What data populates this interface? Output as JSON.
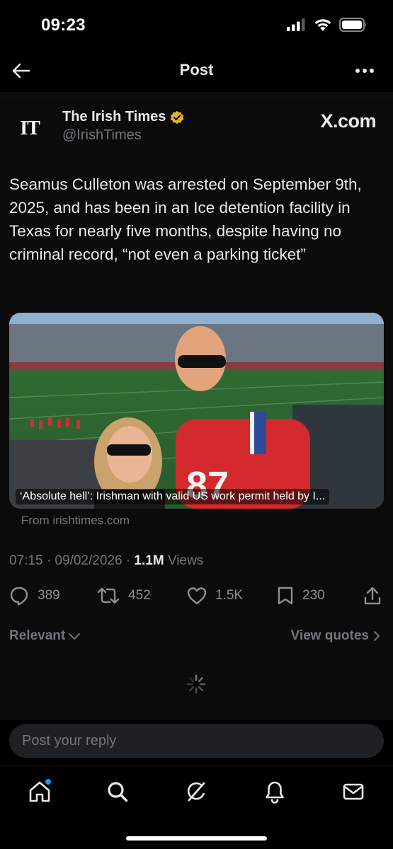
{
  "status": {
    "time": "09:23"
  },
  "header": {
    "title": "Post"
  },
  "post": {
    "author_name": "The Irish Times",
    "author_handle": "@IrishTimes",
    "avatar_text": "IT",
    "source_brand": "X.com",
    "text": "Seamus Culleton was arrested on September 9th, 2025, and has been in an Ice detention facility in Texas for nearly five months, despite having no criminal record, “not even a parking ticket”",
    "link_card": {
      "caption": "‘Absolute hell’: Irishman with valid US work permit held by I...",
      "from": "From irishtimes.com"
    },
    "meta": {
      "timestamp": "07:15 · 09/02/2026 · ",
      "views_count": "1.1M",
      "views_label": " Views"
    },
    "actions": {
      "replies": "389",
      "reposts": "452",
      "likes": "1.5K",
      "bookmarks": "230"
    }
  },
  "sort": {
    "relevant_label": "Relevant",
    "view_quotes_label": "View quotes"
  },
  "reply": {
    "placeholder": "Post your reply"
  },
  "colors": {
    "accent": "#1d9bf0",
    "verified": "#e2b719",
    "muted": "#71767b",
    "text": "#e7e9ea",
    "background": "#000000"
  },
  "icons": {
    "back": "arrow-left-icon",
    "more": "more-horizontal-icon",
    "verified": "verified-badge-icon",
    "reply": "reply-bubble-icon",
    "repost": "repost-icon",
    "like": "heart-icon",
    "bookmark": "bookmark-icon",
    "share": "share-icon",
    "nav": [
      "home-icon",
      "search-icon",
      "grok-icon",
      "notifications-bell-icon",
      "messages-envelope-icon"
    ]
  }
}
